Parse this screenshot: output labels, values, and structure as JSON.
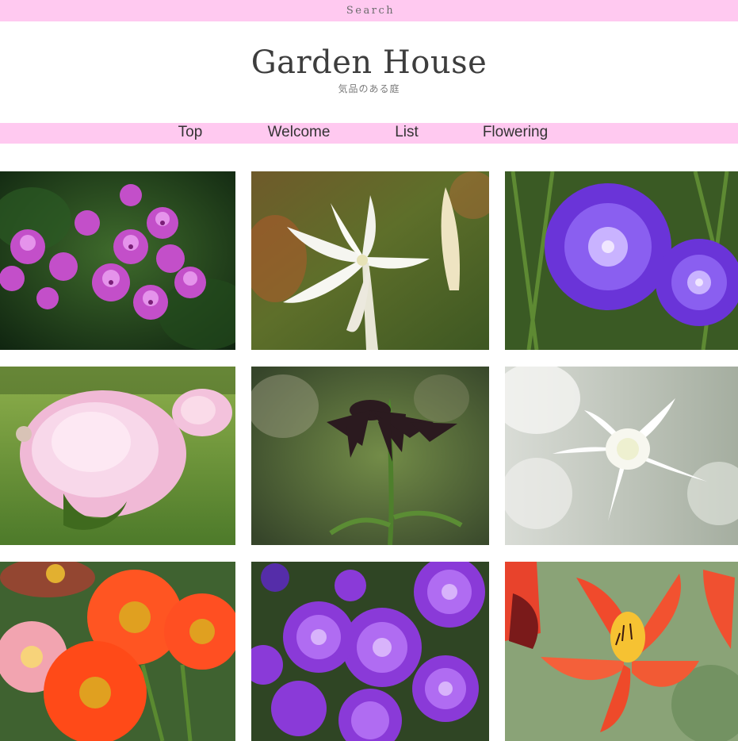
{
  "header": {
    "search_label": "Search"
  },
  "brand": {
    "title": "Garden House",
    "tagline": "気品のある庭"
  },
  "nav": {
    "items": [
      {
        "label": "Top"
      },
      {
        "label": "Welcome"
      },
      {
        "label": "List"
      },
      {
        "label": "Flowering"
      }
    ]
  },
  "colors": {
    "accent_bar": "#ffc9f0",
    "text": "#333333"
  },
  "gallery": {
    "photos": [
      {
        "subject": "pink dianthus flowers"
      },
      {
        "subject": "white crinum lily"
      },
      {
        "subject": "purple stokesia cornflower"
      },
      {
        "subject": "pink peony"
      },
      {
        "subject": "dark chocolate fritillaria"
      },
      {
        "subject": "white eucharis lily"
      },
      {
        "subject": "orange gerbera daisies"
      },
      {
        "subject": "purple aster flowers"
      },
      {
        "subject": "red alstroemeria"
      }
    ]
  }
}
